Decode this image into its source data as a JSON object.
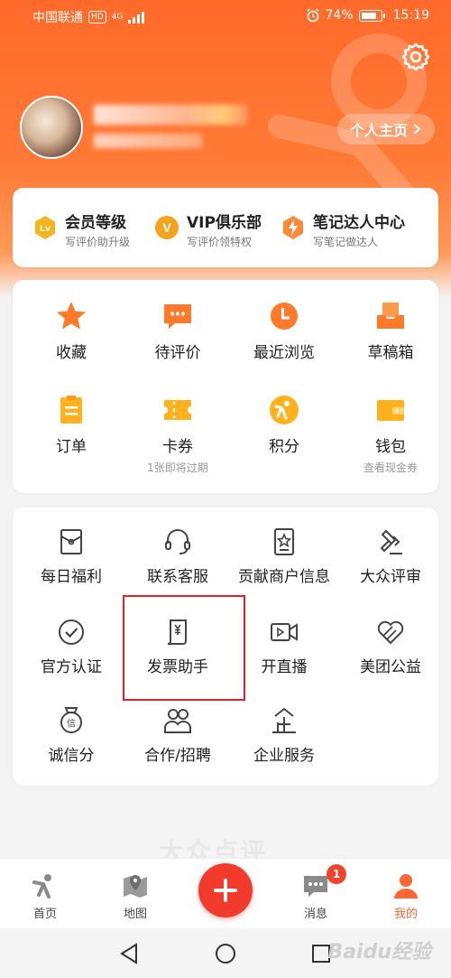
{
  "status_bar": {
    "carrier": "中国联通",
    "hd": "HD",
    "network": "4G",
    "battery": "74%",
    "time": "15:19"
  },
  "profile": {
    "homepage_label": "个人主页"
  },
  "member": [
    {
      "title": "会员等级",
      "sub": "写评价助升级",
      "icon": "lv-badge-icon",
      "icon_text": "Lv",
      "color": "#f5b51e"
    },
    {
      "title": "VIP俱乐部",
      "sub": "写评价领特权",
      "icon": "vip-badge-icon",
      "icon_text": "V",
      "color": "#f5a31e"
    },
    {
      "title": "笔记达人中心",
      "sub": "写笔记做达人",
      "icon": "lightning-badge-icon",
      "icon_text": "⚡",
      "color": "#ff7a2a"
    }
  ],
  "grid1": [
    {
      "label": "收藏",
      "sub": "",
      "icon": "star-icon"
    },
    {
      "label": "待评价",
      "sub": "",
      "icon": "comment-icon"
    },
    {
      "label": "最近浏览",
      "sub": "",
      "icon": "clock-icon"
    },
    {
      "label": "草稿箱",
      "sub": "",
      "icon": "draft-box-icon"
    },
    {
      "label": "订单",
      "sub": "",
      "icon": "order-icon"
    },
    {
      "label": "卡券",
      "sub": "1张即将过期",
      "icon": "coupon-icon"
    },
    {
      "label": "积分",
      "sub": "",
      "icon": "points-icon"
    },
    {
      "label": "钱包",
      "sub": "查看现金券",
      "icon": "wallet-icon"
    }
  ],
  "grid2": [
    {
      "label": "每日福利",
      "icon": "gift-envelope-icon"
    },
    {
      "label": "联系客服",
      "icon": "headset-icon"
    },
    {
      "label": "贡献商户信息",
      "icon": "star-card-icon"
    },
    {
      "label": "大众评审",
      "icon": "gavel-icon"
    },
    {
      "label": "官方认证",
      "icon": "check-circle-icon"
    },
    {
      "label": "发票助手",
      "icon": "invoice-icon"
    },
    {
      "label": "开直播",
      "icon": "live-video-icon"
    },
    {
      "label": "美团公益",
      "icon": "charity-heart-icon"
    },
    {
      "label": "诚信分",
      "icon": "credit-medal-icon"
    },
    {
      "label": "合作/招聘",
      "icon": "people-icon"
    },
    {
      "label": "企业服务",
      "icon": "enterprise-icon"
    }
  ],
  "watermark_logo": "大众点评",
  "tabbar": {
    "tabs": [
      {
        "label": "首页",
        "icon": "home-person-icon"
      },
      {
        "label": "地图",
        "icon": "map-pin-icon"
      },
      {
        "label": "消息",
        "icon": "message-icon"
      },
      {
        "label": "我的",
        "icon": "profile-icon"
      }
    ],
    "message_badge": "1"
  },
  "watermark_site": "Baidu经验",
  "colors": {
    "brand_orange": "#ff6a2a",
    "plus_red": "#f23b2a",
    "highlight_red": "#e0212b"
  }
}
